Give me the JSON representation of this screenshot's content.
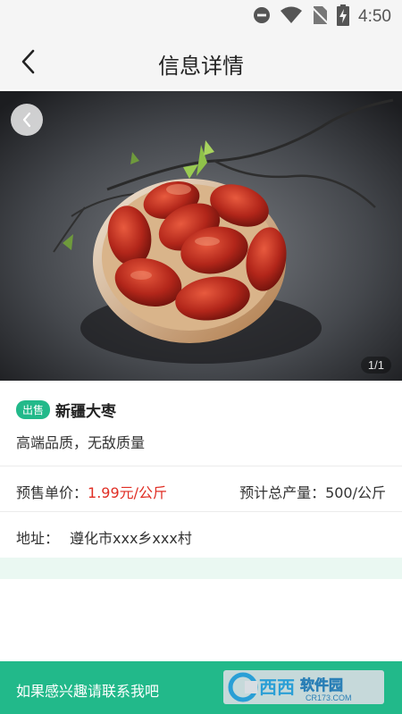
{
  "status_bar": {
    "time": "4:50",
    "icons": [
      "do-not-disturb-icon",
      "wifi-icon",
      "no-sim-icon",
      "battery-charging-icon"
    ]
  },
  "header": {
    "title": "信息详情",
    "back_icon": "chevron-left-icon"
  },
  "gallery": {
    "prev_icon": "chevron-left-icon",
    "counter": "1/1"
  },
  "listing": {
    "badge": "出售",
    "name": "新疆大枣",
    "description": "高端品质，无敌质量",
    "price_label": "预售单价：",
    "price_value": "1.99元/公斤",
    "output_label": "预计总产量：500/公斤",
    "address_label": "地址：",
    "address_value": "遵化市xxx乡xxx村"
  },
  "footer": {
    "contact_text": "如果感兴趣请联系我吧",
    "watermark_text": "西西软件园",
    "watermark_sub": "CR173.COM"
  },
  "colors": {
    "accent": "#22b98a",
    "price": "#e02e24",
    "mint": "#eaf8f2"
  }
}
